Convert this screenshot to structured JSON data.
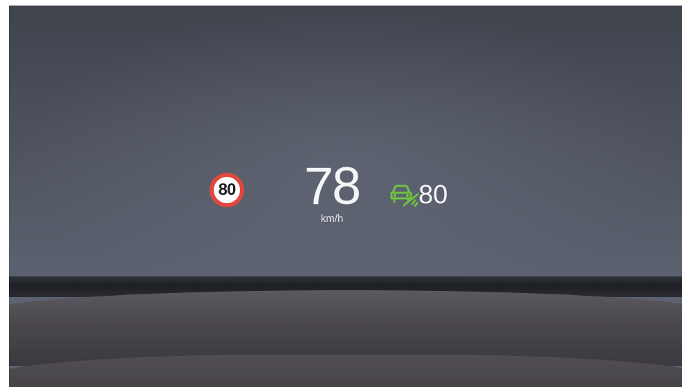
{
  "hud": {
    "speed_limit": "80",
    "current_speed": "78",
    "speed_unit": "km/h",
    "cruise_set_speed": "80",
    "icons": {
      "speed_limit_sign": "speed-limit-sign-icon",
      "cruise": "adaptive-cruise-icon"
    },
    "colors": {
      "sign_ring": "#e2473f",
      "cruise_icon": "#6fc241",
      "text": "#f4f5f7"
    }
  }
}
